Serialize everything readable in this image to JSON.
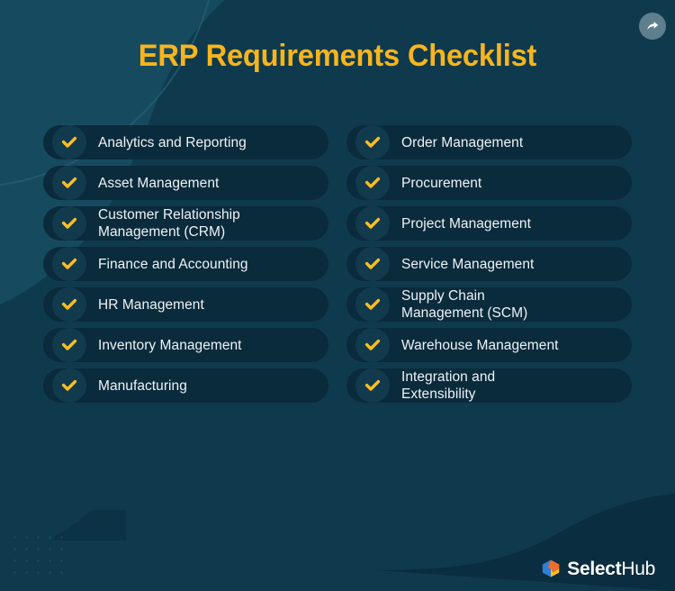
{
  "header": {
    "title": "ERP Requirements Checklist",
    "share_icon": "share-arrow-icon"
  },
  "colors": {
    "background": "#0f3a4d",
    "pill": "#0a2b3c",
    "circle": "#123a4d",
    "accent_yellow": "#f9b41c",
    "check_yellow": "#fcbe1e",
    "text": "#eef3f6",
    "share_button": "#5d7f8e",
    "wave_dark": "#0a2d3f",
    "wave_light": "#164a5f",
    "logo_blue": "#2f7ed8",
    "logo_orange": "#ef6c2a",
    "logo_yellow": "#fcc21b"
  },
  "checklist": {
    "check_icon": "check-icon",
    "left_column": [
      {
        "label": "Analytics and Reporting"
      },
      {
        "label": "Asset Management"
      },
      {
        "label": "Customer Relationship\nManagement (CRM)"
      },
      {
        "label": "Finance and Accounting"
      },
      {
        "label": "HR Management"
      },
      {
        "label": "Inventory Management"
      },
      {
        "label": "Manufacturing"
      }
    ],
    "right_column": [
      {
        "label": "Order Management"
      },
      {
        "label": "Procurement"
      },
      {
        "label": "Project Management"
      },
      {
        "label": "Service Management"
      },
      {
        "label": "Supply Chain\nManagement (SCM)"
      },
      {
        "label": "Warehouse Management"
      },
      {
        "label": "Integration and\nExtensibility"
      }
    ]
  },
  "footer": {
    "logo_mark": "selecthub-cube-icon",
    "logo_bold": "Select",
    "logo_light": "Hub"
  }
}
